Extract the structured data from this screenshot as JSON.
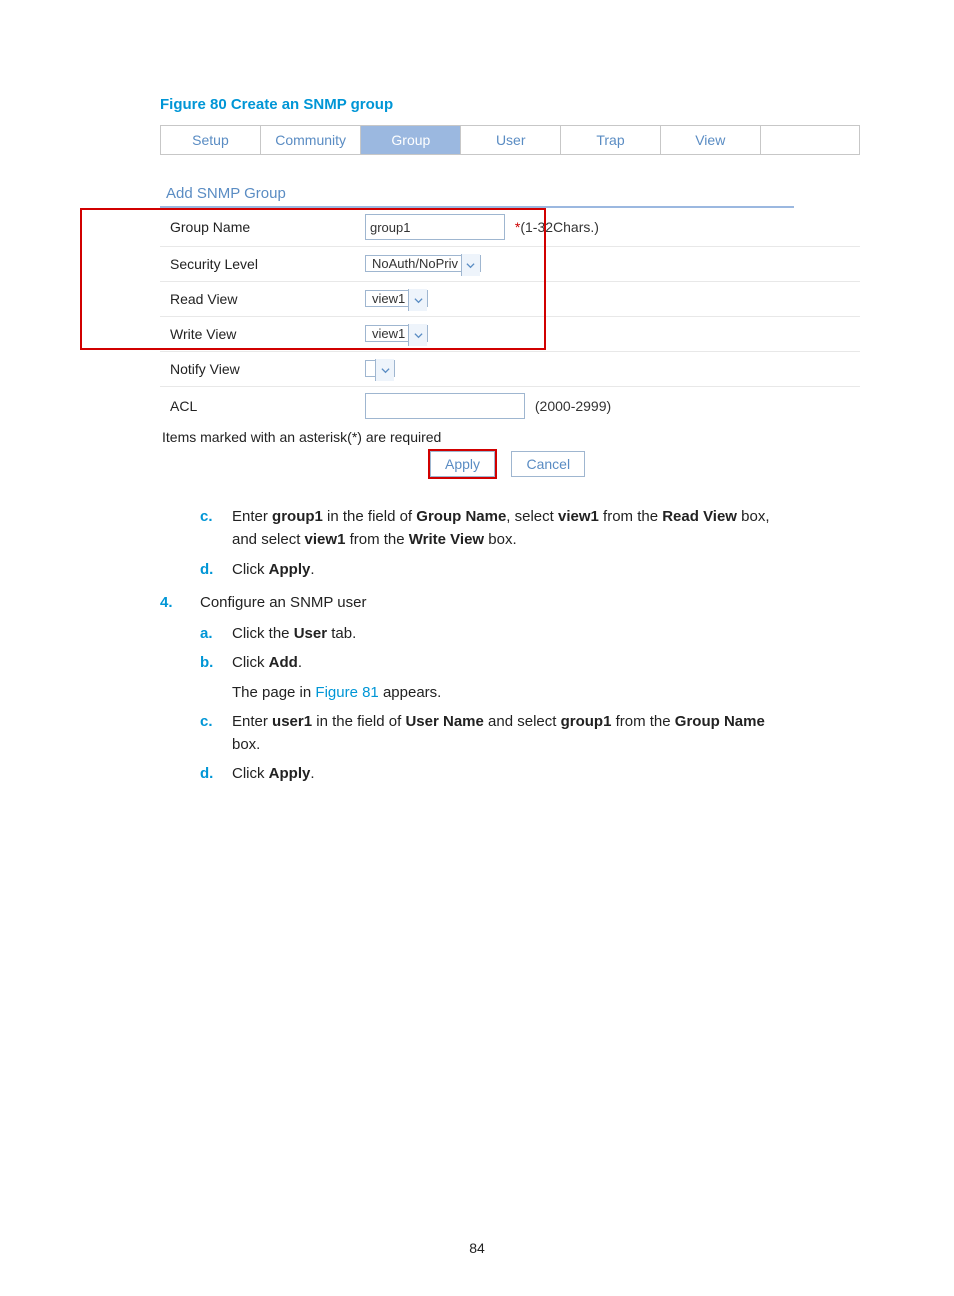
{
  "figure_title": "Figure 80 Create an SNMP group",
  "tabs": [
    "Setup",
    "Community",
    "Group",
    "User",
    "Trap",
    "View",
    ""
  ],
  "active_tab": 2,
  "section_title": "Add SNMP Group",
  "form": {
    "group_name": {
      "label": "Group Name",
      "value": "group1",
      "hint": "(1-32Chars.)",
      "required": true
    },
    "security": {
      "label": "Security Level",
      "value": "NoAuth/NoPriv"
    },
    "read_view": {
      "label": "Read View",
      "value": "view1"
    },
    "write_view": {
      "label": "Write View",
      "value": "view1"
    },
    "notify_view": {
      "label": "Notify View",
      "value": ""
    },
    "acl": {
      "label": "ACL",
      "value": "",
      "hint": "(2000-2999)"
    }
  },
  "note": "Items marked with an asterisk(*) are required",
  "buttons": {
    "apply": "Apply",
    "cancel": "Cancel"
  },
  "steps": {
    "c_pre": "Enter ",
    "c_b1": "group1",
    "c_mid1": " in the field of ",
    "c_b2": "Group Name",
    "c_mid2": ", select ",
    "c_b3": "view1",
    "c_mid3": " from the ",
    "c_b4": "Read View",
    "c_mid4": " box, and select ",
    "c_b5": "view1",
    "c_mid5": " from the ",
    "c_b6": "Write View",
    "c_end": " box.",
    "d_pre": "Click ",
    "d_b": "Apply",
    "d_end": ".",
    "n4": "Configure an SNMP user",
    "sa_pre": "Click the ",
    "sa_b": "User",
    "sa_end": " tab.",
    "sb_pre": "Click ",
    "sb_b": "Add",
    "sb_end": ".",
    "sb2_pre": "The page in ",
    "sb2_link": "Figure 81",
    "sb2_end": " appears.",
    "sc_pre": "Enter ",
    "sc_b1": "user1",
    "sc_mid1": " in the field of ",
    "sc_b2": "User Name",
    "sc_mid2": " and select ",
    "sc_b3": "group1",
    "sc_mid3": " from the ",
    "sc_b4": "Group Name",
    "sc_end": " box.",
    "sd_pre": "Click ",
    "sd_b": "Apply",
    "sd_end": "."
  },
  "page_no": "84"
}
